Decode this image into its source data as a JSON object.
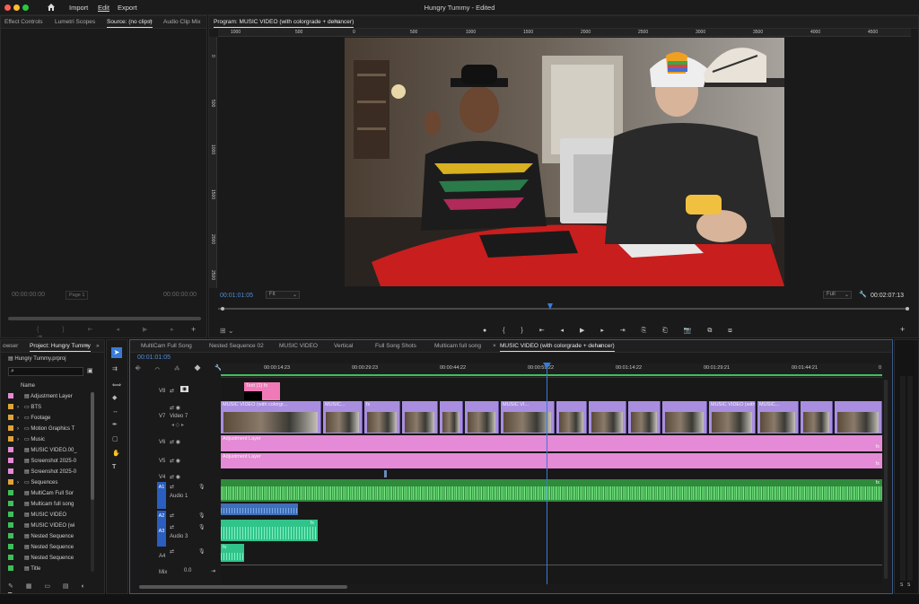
{
  "window": {
    "title": "Hungry Tummy - Edited"
  },
  "menu": {
    "home_icon": "home-icon",
    "import": "Import",
    "edit": "Edit",
    "export": "Export"
  },
  "colors": {
    "accent": "#4f8cd6",
    "video_clip": "#a98ee0",
    "adjustment": "#e58ad6",
    "audio_clip": "#2f8a3c",
    "audio_alt": "#31c48a",
    "title_clip": "#f07ab8",
    "playhead": "#3a7bd5"
  },
  "source_panel": {
    "tabs": [
      "Effect Controls",
      "Lumetri Scopes",
      "Source: (no clips)",
      "Audio Clip Mix"
    ],
    "timecode_in": "00:00:00:00",
    "page": "Page 1",
    "timecode_out": "00:00:00:00"
  },
  "program_panel": {
    "tab": "Program: MUSIC VIDEO (with colorgrade + dehancer)",
    "ruler": [
      "1000",
      "500",
      "0",
      "500",
      "1000",
      "1500",
      "2000",
      "2500",
      "3000",
      "3500",
      "4000",
      "4500"
    ],
    "vruler": [
      "0",
      "500",
      "1000",
      "1500",
      "2000",
      "2500"
    ],
    "timecode": "00:01:01:05",
    "fit": "Fit",
    "quality": "Full",
    "duration": "00:02:07:13"
  },
  "project_panel": {
    "tabs": [
      "owser",
      "Project: Hungry Tummy"
    ],
    "file": "Hungry Tummy.prproj",
    "col_name": "Name",
    "items": [
      {
        "name": "Adjustment Layer",
        "color": "#e58ad6",
        "expand": false
      },
      {
        "name": "BTS",
        "color": "#e0a33a",
        "expand": true
      },
      {
        "name": "Footage",
        "color": "#e0a33a",
        "expand": true
      },
      {
        "name": "Motion Graphics T",
        "color": "#e0a33a",
        "expand": true
      },
      {
        "name": "Music",
        "color": "#e0a33a",
        "expand": true
      },
      {
        "name": "MUSIC VIDEO.00_",
        "color": "#e58ad6",
        "expand": false
      },
      {
        "name": "Screenshot 2025-0",
        "color": "#e58ad6",
        "expand": false
      },
      {
        "name": "Screenshot 2025-0",
        "color": "#e58ad6",
        "expand": false
      },
      {
        "name": "Sequences",
        "color": "#e0a33a",
        "expand": true
      },
      {
        "name": "MultiCam Full Sor",
        "color": "#3fbf5a",
        "expand": false
      },
      {
        "name": "Multicam full song",
        "color": "#3fbf5a",
        "expand": false
      },
      {
        "name": "MUSIC VIDEO",
        "color": "#3fbf5a",
        "expand": false
      },
      {
        "name": "MUSIC VIDEO (wi",
        "color": "#3fbf5a",
        "expand": false
      },
      {
        "name": "Nested Sequence",
        "color": "#3fbf5a",
        "expand": false
      },
      {
        "name": "Nested Sequence",
        "color": "#3fbf5a",
        "expand": false
      },
      {
        "name": "Nested Sequence",
        "color": "#3fbf5a",
        "expand": false
      },
      {
        "name": "Title",
        "color": "#3fbf5a",
        "expand": false
      }
    ]
  },
  "timeline": {
    "tabs": [
      "MultiCam Full Song",
      "Nested Sequence 02",
      "MUSIC VIDEO",
      "Vertical",
      "Full Song Shots",
      "Multicam full song",
      "MUSIC VIDEO (with colorgrade + dehancer)"
    ],
    "timecode": "00:01:01:05",
    "ruler": [
      "00:00:14:23",
      "00:00:29:23",
      "00:00:44:22",
      "00:00:59:22",
      "00:01:14:22",
      "00:01:29:21",
      "00:01:44:21",
      "0"
    ],
    "tracks": {
      "v8": "V8",
      "v7": "V7",
      "v7_name": "Video 7",
      "v6": "V6",
      "v5": "V5",
      "v4": "V4",
      "a1": "A1",
      "a1_name": "Audio 1",
      "a2": "A2",
      "a3": "A3",
      "a3_name": "Audio 3",
      "a4": "A4",
      "mix": "Mix",
      "mix_val": "0.0"
    },
    "title_clip": "Text (1)",
    "video_clip_label": "MUSIC VIDEO (with colorgr...",
    "video_clip_short": "MUSIC...",
    "video_clip_short2": "MUSIC VI...",
    "video_clip_mid": "MUSIC VIDEO (with...",
    "adjustment_label": "Adjustment Layer",
    "fx": "fx",
    "track_m": "M",
    "track_s": "S"
  },
  "meter": {
    "labels": [
      "S",
      "S"
    ]
  }
}
